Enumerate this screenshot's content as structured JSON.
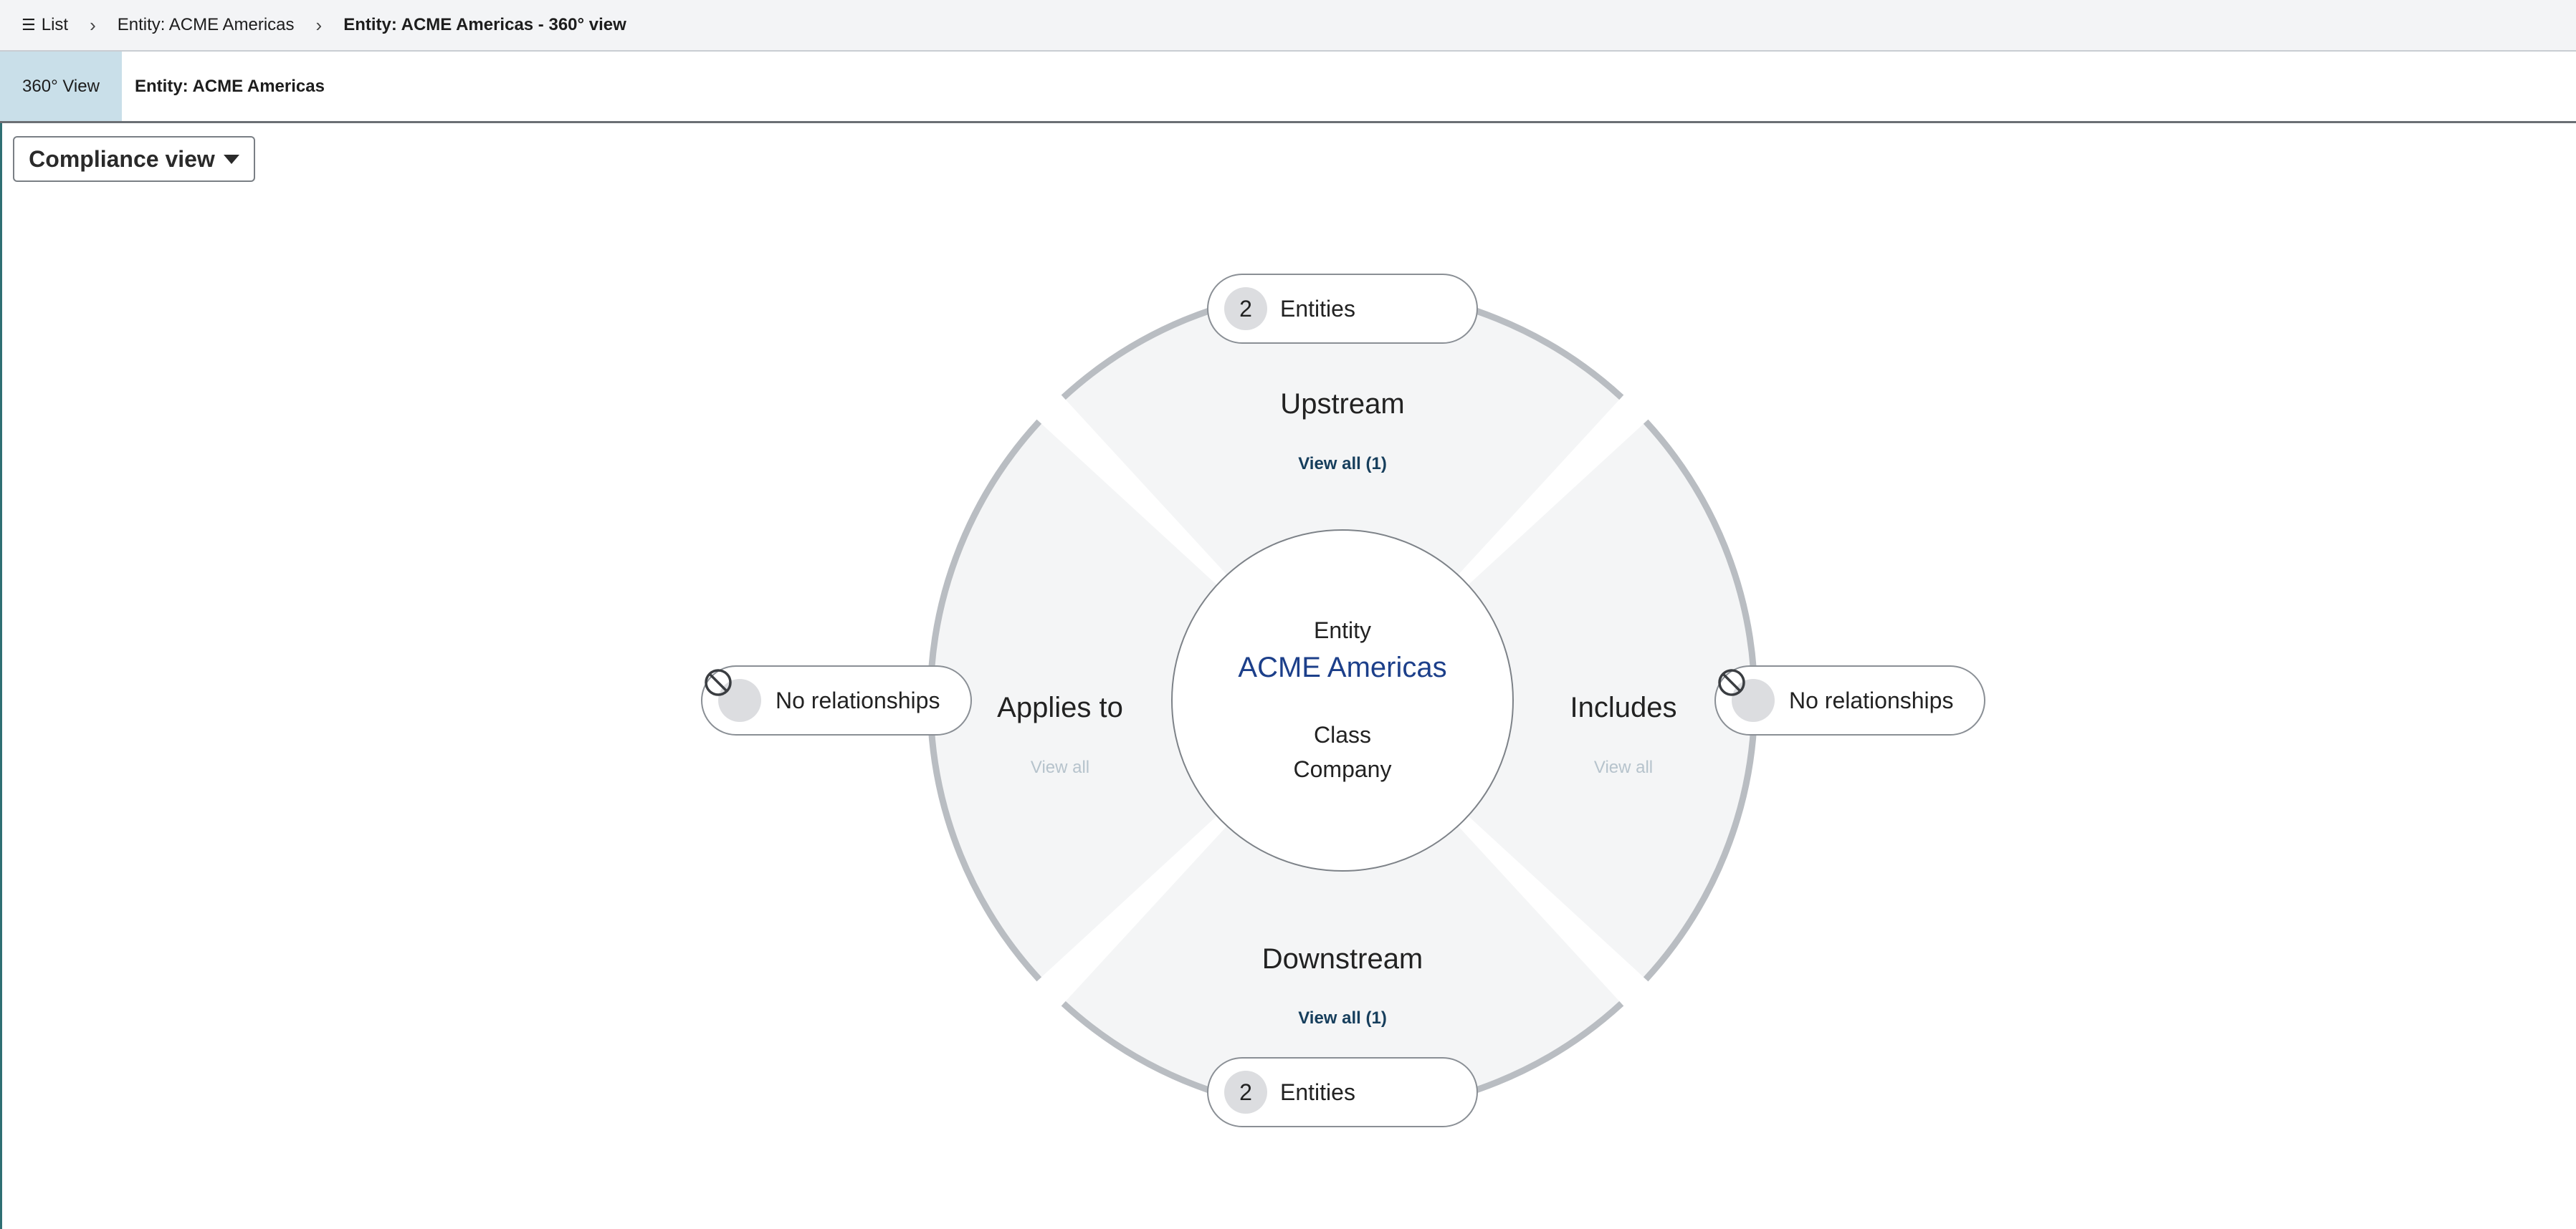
{
  "breadcrumb": {
    "items": [
      "List",
      "Entity: ACME Americas",
      "Entity: ACME Americas - 360° view"
    ],
    "list_icon": "list-icon",
    "separator_icon": "chevron-right-icon"
  },
  "tabs": {
    "active": "360° View",
    "title": "Entity: ACME Americas"
  },
  "view_selector": {
    "label": "Compliance view",
    "icon": "caret-down-icon"
  },
  "center": {
    "type_label": "Entity",
    "name": "ACME Americas",
    "class_label": "Class",
    "class_value": "Company"
  },
  "sectors": {
    "upstream": {
      "title": "Upstream",
      "view_all": "View all (1)",
      "count": "2",
      "count_label": "Entities"
    },
    "downstream": {
      "title": "Downstream",
      "view_all": "View all (1)",
      "count": "2",
      "count_label": "Entities"
    },
    "applies_to": {
      "title": "Applies to",
      "view_all": "View all",
      "status": "No relationships",
      "status_icon": "no-entry-icon"
    },
    "includes": {
      "title": "Includes",
      "view_all": "View all",
      "status": "No relationships",
      "status_icon": "no-entry-icon"
    }
  },
  "colors": {
    "sector_fill": "#f4f5f6",
    "ring": "#b9bdc2",
    "link": "#163e5c",
    "center_name": "#1c3f8a",
    "active_tab": "#c9dfe9"
  }
}
